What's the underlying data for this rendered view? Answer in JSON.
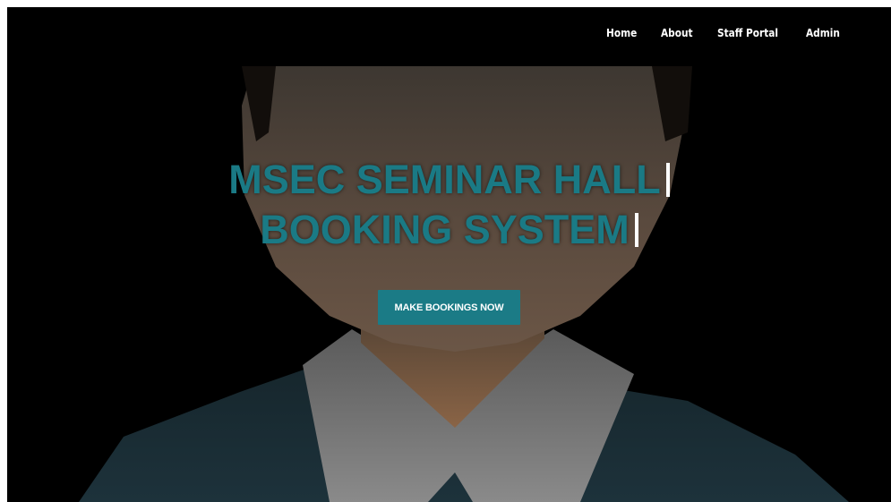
{
  "nav": {
    "items": [
      {
        "label": "Home"
      },
      {
        "label": "About"
      },
      {
        "label": "Staff Portal"
      },
      {
        "label": "Admin"
      }
    ]
  },
  "hero": {
    "title_line1": "MSEC SEMINAR HALL",
    "title_line2": "BOOKING SYSTEM",
    "cta_label": "MAKE BOOKINGS NOW"
  },
  "colors": {
    "accent": "#1b7b86",
    "title": "#1a7a85",
    "background": "#000000",
    "nav_text": "#ffffff"
  }
}
